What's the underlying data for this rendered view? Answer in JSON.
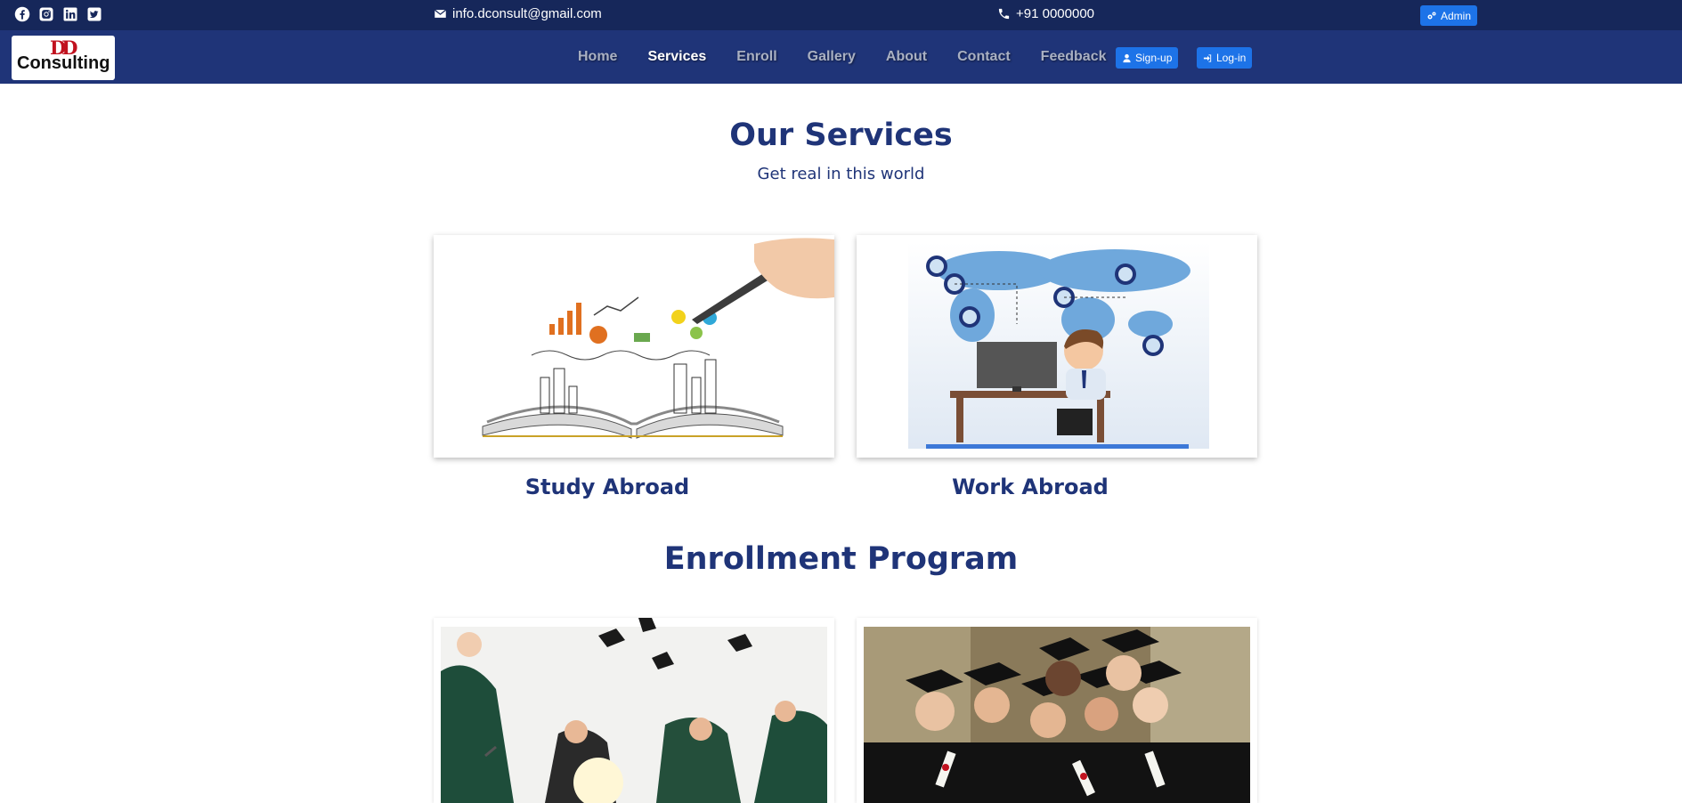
{
  "topbar": {
    "social_icons": [
      "facebook-icon",
      "instagram-icon",
      "linkedin-icon",
      "twitter-icon"
    ],
    "email": "info.dconsult@gmail.com",
    "phone": "+91 0000000",
    "admin_label": "Admin"
  },
  "navbar": {
    "logo_mark": "DD",
    "logo_text": "Consulting",
    "links": [
      "Home",
      "Services",
      "Enroll",
      "Gallery",
      "About",
      "Contact",
      "Feedback"
    ],
    "active_link": "Services",
    "signup_label": "Sign-up",
    "login_label": "Log-in"
  },
  "services": {
    "title": "Our Services",
    "subtitle": "Get real in this world",
    "cards": [
      {
        "title": "Study Abroad"
      },
      {
        "title": "Work Abroad"
      }
    ]
  },
  "enrollment": {
    "title": "Enrollment Program"
  },
  "colors": {
    "topbar": "#16275a",
    "navbar": "#1f3478",
    "accent_button": "#1d73e8",
    "heading": "#1f3478"
  }
}
